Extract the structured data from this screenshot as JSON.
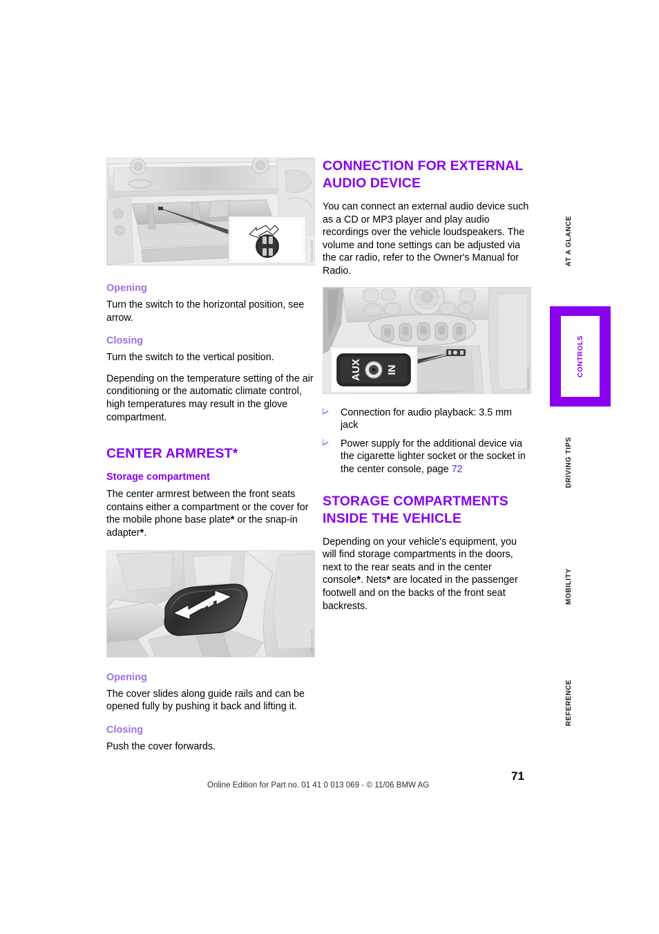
{
  "page": {
    "number": "71",
    "footer_note": "Online Edition for Part no. 01 41 0 013 069 - © 11/06 BMW AG"
  },
  "colors": {
    "heading_violet": "#8800ee",
    "subheading_violet": "#a070e2",
    "page_link_blue": "#3a3ad6",
    "tab_active_bg": "#8800ee",
    "figure_bg": "#eef0ef"
  },
  "side_tabs": [
    {
      "label": "AT A GLANCE",
      "active": false
    },
    {
      "label": "CONTROLS",
      "active": true
    },
    {
      "label": "DRIVING TIPS",
      "active": false
    },
    {
      "label": "MOBILITY",
      "active": false
    },
    {
      "label": "REFERENCE",
      "active": false
    }
  ],
  "left_column": {
    "figure_glovebox": {
      "caption_code": "WW0181 000S",
      "alt": "Glove compartment switch with inset showing rotary knob and arrow"
    },
    "opening_1": {
      "heading": "Opening",
      "text": "Turn the switch to the horizontal position, see arrow."
    },
    "closing_1": {
      "heading": "Closing",
      "text": "Turn the switch to the vertical position.",
      "text2": "Depending on the temperature setting of the air conditioning or the automatic climate control, high temperatures may result in the glove compartment."
    },
    "center_armrest": {
      "title": "CENTER ARMREST",
      "title_star": "*",
      "storage_heading": "Storage compartment",
      "storage_text_a": "The center armrest between the front seats contains either a compartment or the cover for the mobile phone base plate",
      "storage_text_b": " or the snap-in adapter",
      "storage_text_c": "."
    },
    "figure_armrest": {
      "caption_code": "WW0181 7920S",
      "alt": "Center armrest between front seats with double arrow showing sliding cover"
    },
    "opening_2": {
      "heading": "Opening",
      "text": "The cover slides along guide rails and can be opened fully by pushing it back and lifting it."
    },
    "closing_2": {
      "heading": "Closing",
      "text": "Push the cover forwards."
    }
  },
  "right_column": {
    "audio_section": {
      "title_line1": "CONNECTION FOR EXTERNAL",
      "title_line2": "AUDIO DEVICE",
      "intro": "You can connect an external audio device such as a CD or MP3 player and play audio recordings over the vehicle loudspeakers. The volume and tone settings can be adjusted via the car radio, refer to the Owner's Manual for Radio."
    },
    "figure_aux": {
      "caption_code": "WW0361 5030S",
      "alt": "Center console detail with inset showing AUX IN socket",
      "inset_label_left": "AUX",
      "inset_label_right": "IN"
    },
    "bullets": [
      {
        "text": "Connection for audio playback: 3.5 mm jack"
      },
      {
        "text_before": "Power supply for the additional device via the cigarette lighter socket or the socket in the center console, page ",
        "page_ref": "72"
      }
    ],
    "storage_section": {
      "title_line1": "STORAGE COMPARTMENTS",
      "title_line2": "INSIDE THE VEHICLE",
      "text_a": "Depending on your vehicle's equipment, you will find storage compartments in the doors, next to the rear seats and in the center console",
      "text_b": ". Nets",
      "text_c": " are located in the passenger footwell and on the backs of the front seat backrests."
    }
  }
}
